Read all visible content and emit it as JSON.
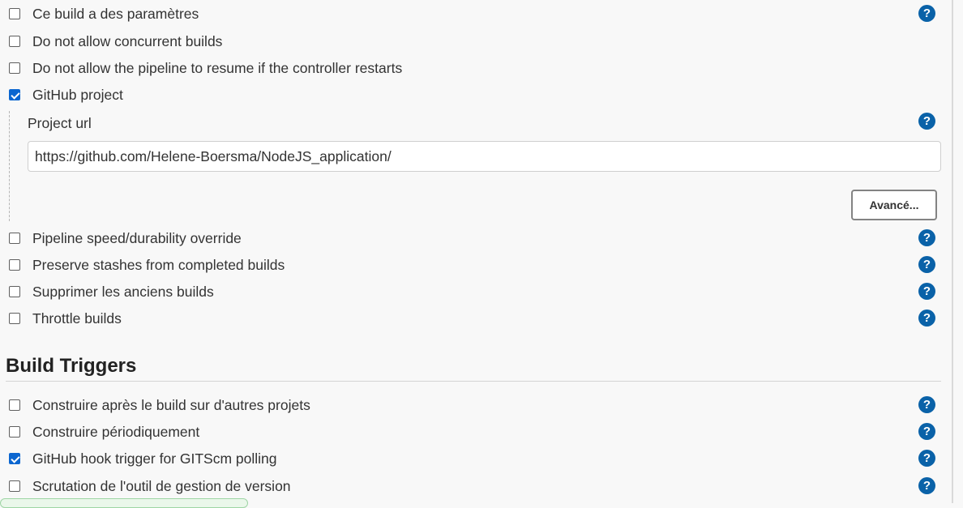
{
  "general_options": [
    {
      "label": "Ce build a des paramètres",
      "checked": false,
      "help_icon": "help-icon"
    },
    {
      "label": "Do not allow concurrent builds",
      "checked": false
    },
    {
      "label": "Do not allow the pipeline to resume if the controller restarts",
      "checked": false
    },
    {
      "label": "GitHub project",
      "checked": true
    }
  ],
  "github_project": {
    "url_label": "Project url",
    "url_value": "https://github.com/Helene-Boersma/NodeJS_application/",
    "advanced_button": "Avancé..."
  },
  "more_options": [
    {
      "label": "Pipeline speed/durability override",
      "checked": false
    },
    {
      "label": "Preserve stashes from completed builds",
      "checked": false
    },
    {
      "label": "Supprimer les anciens builds",
      "checked": false
    },
    {
      "label": "Throttle builds",
      "checked": false
    }
  ],
  "build_triggers": {
    "title": "Build Triggers",
    "options": [
      {
        "label": "Construire après le build sur d'autres projets",
        "checked": false
      },
      {
        "label": "Construire périodiquement",
        "checked": false
      },
      {
        "label": "GitHub hook trigger for GITScm polling",
        "checked": true
      },
      {
        "label": "Scrutation de l'outil de gestion de version",
        "checked": false
      }
    ]
  },
  "help_glyph": "?",
  "colors": {
    "checkbox_checked": "#0b66d0",
    "help_icon": "#0a62a8",
    "background": "#f8f8f8"
  }
}
